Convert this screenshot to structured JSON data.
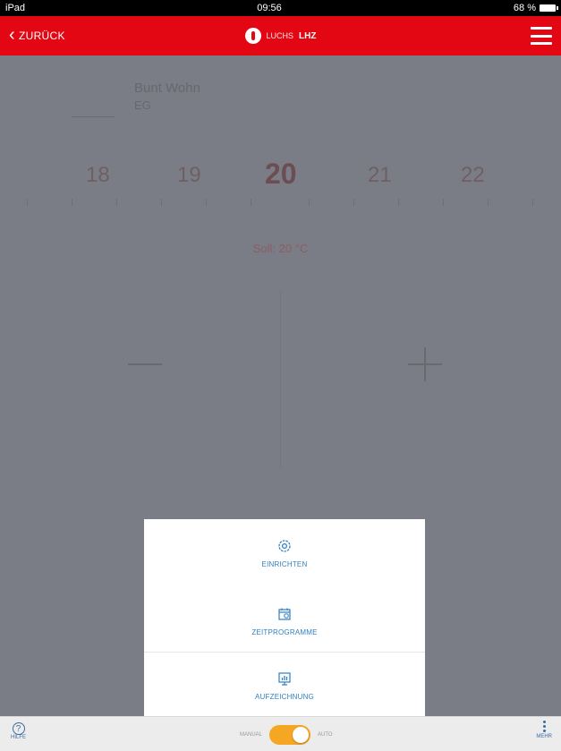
{
  "status_bar": {
    "carrier": "iPad",
    "time": "09:56",
    "battery": "68 %"
  },
  "top_bar": {
    "back_label": "ZURÜCK",
    "brand_small": "LUCHS",
    "brand_bold": "LHZ"
  },
  "room": {
    "name": "Bunt Wohn",
    "sub": "EG"
  },
  "scale": {
    "values": [
      "18",
      "19",
      "20",
      "21",
      "22"
    ],
    "selected": "20"
  },
  "target_label": "Soll: 20 °C",
  "popup": {
    "items": [
      {
        "label": "EINRICHTEN",
        "icon": "gear-icon"
      },
      {
        "label": "ZEITPROGRAMME",
        "icon": "calendar-icon"
      },
      {
        "label": "AUFZEICHNUNG",
        "icon": "chart-icon"
      }
    ]
  },
  "bottom_bar": {
    "help_label": "HILFE",
    "mode_left": "MANUAL",
    "mode_right": "AUTO",
    "more_label": "MEHR"
  },
  "colors": {
    "accent": "#e30613",
    "link": "#2f7fc1",
    "toggle": "#f5a623"
  }
}
